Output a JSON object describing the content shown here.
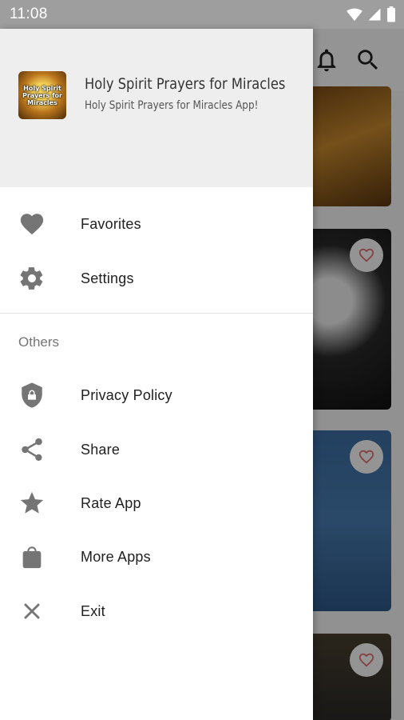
{
  "status_bar": {
    "time": "11:08"
  },
  "drawer": {
    "header": {
      "app_name": "Holy Spirit Prayers for Miracles",
      "app_tagline": "Holy Spirit Prayers for Miracles App!",
      "logo_text": "Holy Spirit Prayers for Miracles"
    },
    "main_items": [
      {
        "label": "Favorites",
        "icon": "heart-icon"
      },
      {
        "label": "Settings",
        "icon": "gear-icon"
      }
    ],
    "section_title": "Others",
    "other_items": [
      {
        "label": "Privacy Policy",
        "icon": "shield-lock-icon"
      },
      {
        "label": "Share",
        "icon": "share-icon"
      },
      {
        "label": "Rate App",
        "icon": "star-icon"
      },
      {
        "label": "More Apps",
        "icon": "shopping-bag-icon"
      },
      {
        "label": "Exit",
        "icon": "close-icon"
      }
    ]
  },
  "colors": {
    "icon_gray": "#757575",
    "header_bg": "#eeeeee",
    "status_bar_bg": "#9e9e9e",
    "favorite_accent": "#e57373"
  }
}
